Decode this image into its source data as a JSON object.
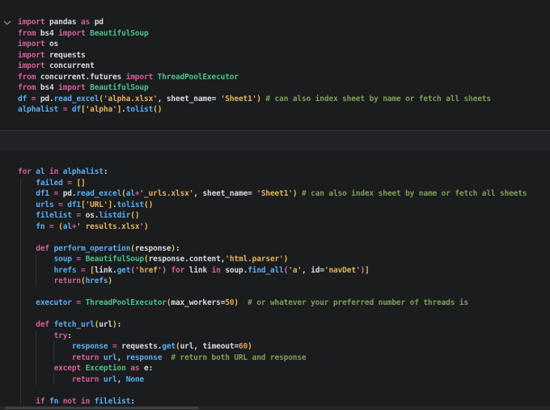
{
  "editor": {
    "palette": {
      "kw": "#d45f9c",
      "v": "#58aef2",
      "c": "#4cc08a",
      "s": "#e1b05e",
      "n": "#dda05c",
      "cm": "#7d9e57",
      "pl": "#d6dae2",
      "b1": "#e8c64b",
      "b2": "#d577d1"
    },
    "cells": [
      {
        "name": "imports-cell",
        "lines": [
          [
            [
              "import",
              "kw"
            ],
            [
              " pandas ",
              "pl"
            ],
            [
              "as",
              "kw"
            ],
            [
              " pd",
              "pl"
            ]
          ],
          [
            [
              "from",
              "kw"
            ],
            [
              " bs4 ",
              "pl"
            ],
            [
              "import",
              "kw"
            ],
            [
              " ",
              "pl"
            ],
            [
              "BeautifulSoup",
              "c"
            ]
          ],
          [
            [
              "import",
              "kw"
            ],
            [
              " os",
              "pl"
            ]
          ],
          [
            [
              "import",
              "kw"
            ],
            [
              " requests",
              "pl"
            ]
          ],
          [
            [
              "import",
              "kw"
            ],
            [
              " concurrent",
              "pl"
            ]
          ],
          [
            [
              "from",
              "kw"
            ],
            [
              " concurrent.futures ",
              "pl"
            ],
            [
              "import",
              "kw"
            ],
            [
              " ",
              "pl"
            ],
            [
              "ThreadPoolExecutor",
              "c"
            ]
          ],
          [
            [
              "from",
              "kw"
            ],
            [
              " bs4 ",
              "pl"
            ],
            [
              "import",
              "kw"
            ],
            [
              " ",
              "pl"
            ],
            [
              "BeautifulSoup",
              "c"
            ]
          ],
          [
            [
              "df",
              "v"
            ],
            [
              " ",
              "pl"
            ],
            [
              "=",
              "kw"
            ],
            [
              " pd",
              "pl"
            ],
            [
              ".",
              "pl"
            ],
            [
              "read_excel",
              "v"
            ],
            [
              "(",
              "b1"
            ],
            [
              "'alpha.xlsx'",
              "s"
            ],
            [
              ", ",
              "pl"
            ],
            [
              "sheet_name",
              "pl"
            ],
            [
              "= ",
              "pl"
            ],
            [
              "'Sheet1'",
              "s"
            ],
            [
              ")",
              "b1"
            ],
            [
              " ",
              "pl"
            ],
            [
              "# can also index sheet by name or fetch all sheets",
              "cm"
            ]
          ],
          [
            [
              "alphalist",
              "v"
            ],
            [
              " ",
              "pl"
            ],
            [
              "=",
              "kw"
            ],
            [
              " ",
              "pl"
            ],
            [
              "df",
              "v"
            ],
            [
              "[",
              "b1"
            ],
            [
              "'alpha'",
              "s"
            ],
            [
              "]",
              "b1"
            ],
            [
              ".",
              "pl"
            ],
            [
              "tolist",
              "v"
            ],
            [
              "(",
              "b1"
            ],
            [
              ")",
              "b1"
            ]
          ]
        ]
      },
      {
        "name": "loop-cell",
        "lines": [
          [
            [
              "for",
              "kw"
            ],
            [
              " ",
              "pl"
            ],
            [
              "al",
              "v"
            ],
            [
              " ",
              "pl"
            ],
            [
              "in",
              "kw"
            ],
            [
              " ",
              "pl"
            ],
            [
              "alphalist",
              "v"
            ],
            [
              ":",
              "pl"
            ]
          ],
          [
            [
              "    ",
              "pl"
            ],
            [
              "failed",
              "v"
            ],
            [
              " ",
              "pl"
            ],
            [
              "=",
              "kw"
            ],
            [
              " ",
              "pl"
            ],
            [
              "[]",
              "b1"
            ]
          ],
          [
            [
              "    ",
              "pl"
            ],
            [
              "df1",
              "v"
            ],
            [
              " ",
              "pl"
            ],
            [
              "=",
              "kw"
            ],
            [
              " pd",
              "pl"
            ],
            [
              ".",
              "pl"
            ],
            [
              "read_excel",
              "v"
            ],
            [
              "(",
              "b1"
            ],
            [
              "al",
              "v"
            ],
            [
              "+",
              "kw"
            ],
            [
              "'_urls.xlsx'",
              "s"
            ],
            [
              ", ",
              "pl"
            ],
            [
              "sheet_name",
              "pl"
            ],
            [
              "= ",
              "pl"
            ],
            [
              "'Sheet1'",
              "s"
            ],
            [
              ")",
              "b1"
            ],
            [
              " ",
              "pl"
            ],
            [
              "# can also index sheet by name or fetch all sheets",
              "cm"
            ]
          ],
          [
            [
              "    ",
              "pl"
            ],
            [
              "urls",
              "v"
            ],
            [
              " ",
              "pl"
            ],
            [
              "=",
              "kw"
            ],
            [
              " ",
              "pl"
            ],
            [
              "df1",
              "v"
            ],
            [
              "[",
              "b1"
            ],
            [
              "'URL'",
              "s"
            ],
            [
              "]",
              "b1"
            ],
            [
              ".",
              "pl"
            ],
            [
              "tolist",
              "v"
            ],
            [
              "(",
              "b1"
            ],
            [
              ")",
              "b1"
            ]
          ],
          [
            [
              "    ",
              "pl"
            ],
            [
              "filelist",
              "v"
            ],
            [
              " ",
              "pl"
            ],
            [
              "=",
              "kw"
            ],
            [
              " os",
              "pl"
            ],
            [
              ".",
              "pl"
            ],
            [
              "listdir",
              "v"
            ],
            [
              "(",
              "b1"
            ],
            [
              ")",
              "b1"
            ]
          ],
          [
            [
              "    ",
              "pl"
            ],
            [
              "fn",
              "v"
            ],
            [
              " ",
              "pl"
            ],
            [
              "=",
              "kw"
            ],
            [
              " ",
              "pl"
            ],
            [
              "(",
              "b1"
            ],
            [
              "al",
              "v"
            ],
            [
              "+",
              "kw"
            ],
            [
              "' results.xlsx'",
              "s"
            ],
            [
              ")",
              "b1"
            ]
          ],
          [],
          [
            [
              "    ",
              "pl"
            ],
            [
              "def",
              "kw"
            ],
            [
              " ",
              "pl"
            ],
            [
              "perform_operation",
              "v"
            ],
            [
              "(",
              "b1"
            ],
            [
              "response",
              "pl"
            ],
            [
              ")",
              "b1"
            ],
            [
              ":",
              "pl"
            ]
          ],
          [
            [
              "        ",
              "pl"
            ],
            [
              "soup",
              "v"
            ],
            [
              " ",
              "pl"
            ],
            [
              "=",
              "kw"
            ],
            [
              " ",
              "pl"
            ],
            [
              "BeautifulSoup",
              "c"
            ],
            [
              "(",
              "b1"
            ],
            [
              "response.content",
              "pl"
            ],
            [
              ",",
              "pl"
            ],
            [
              "'html.parser'",
              "s"
            ],
            [
              ")",
              "b1"
            ]
          ],
          [
            [
              "        ",
              "pl"
            ],
            [
              "hrefs",
              "v"
            ],
            [
              " ",
              "pl"
            ],
            [
              "=",
              "kw"
            ],
            [
              " ",
              "pl"
            ],
            [
              "[",
              "b1"
            ],
            [
              "link",
              "pl"
            ],
            [
              ".",
              "pl"
            ],
            [
              "get",
              "v"
            ],
            [
              "(",
              "b2"
            ],
            [
              "'href'",
              "s"
            ],
            [
              ")",
              "b2"
            ],
            [
              " ",
              "pl"
            ],
            [
              "for",
              "kw"
            ],
            [
              " link ",
              "pl"
            ],
            [
              "in",
              "kw"
            ],
            [
              " soup",
              "pl"
            ],
            [
              ".",
              "pl"
            ],
            [
              "find_all",
              "v"
            ],
            [
              "(",
              "b2"
            ],
            [
              "'a'",
              "s"
            ],
            [
              ", ",
              "pl"
            ],
            [
              "id",
              "pl"
            ],
            [
              "=",
              "pl"
            ],
            [
              "'navDet'",
              "s"
            ],
            [
              ")",
              "b2"
            ],
            [
              "]",
              "b1"
            ]
          ],
          [
            [
              "        ",
              "pl"
            ],
            [
              "return",
              "kw"
            ],
            [
              "(",
              "b1"
            ],
            [
              "hrefs",
              "v"
            ],
            [
              ")",
              "b1"
            ]
          ],
          [],
          [
            [
              "    ",
              "pl"
            ],
            [
              "executor",
              "v"
            ],
            [
              " ",
              "pl"
            ],
            [
              "=",
              "kw"
            ],
            [
              " ",
              "pl"
            ],
            [
              "ThreadPoolExecutor",
              "c"
            ],
            [
              "(",
              "b1"
            ],
            [
              "max_workers",
              "pl"
            ],
            [
              "=",
              "pl"
            ],
            [
              "50",
              "n"
            ],
            [
              ")",
              "b1"
            ],
            [
              "  ",
              "pl"
            ],
            [
              "# or whatever your preferred number of threads is",
              "cm"
            ]
          ],
          [],
          [
            [
              "    ",
              "pl"
            ],
            [
              "def",
              "kw"
            ],
            [
              " ",
              "pl"
            ],
            [
              "fetch_url",
              "v"
            ],
            [
              "(",
              "b1"
            ],
            [
              "url",
              "pl"
            ],
            [
              ")",
              "b1"
            ],
            [
              ":",
              "pl"
            ]
          ],
          [
            [
              "        ",
              "pl"
            ],
            [
              "try",
              "kw"
            ],
            [
              ":",
              "pl"
            ]
          ],
          [
            [
              "            ",
              "pl"
            ],
            [
              "response",
              "v"
            ],
            [
              " ",
              "pl"
            ],
            [
              "=",
              "kw"
            ],
            [
              " requests",
              "pl"
            ],
            [
              ".",
              "pl"
            ],
            [
              "get",
              "v"
            ],
            [
              "(",
              "b1"
            ],
            [
              "url",
              "pl"
            ],
            [
              ", ",
              "pl"
            ],
            [
              "timeout",
              "pl"
            ],
            [
              "=",
              "pl"
            ],
            [
              "60",
              "n"
            ],
            [
              ")",
              "b1"
            ]
          ],
          [
            [
              "            ",
              "pl"
            ],
            [
              "return",
              "kw"
            ],
            [
              " ",
              "pl"
            ],
            [
              "url",
              "v"
            ],
            [
              ", ",
              "pl"
            ],
            [
              "response",
              "v"
            ],
            [
              "  ",
              "pl"
            ],
            [
              "# return both URL and response",
              "cm"
            ]
          ],
          [
            [
              "        ",
              "pl"
            ],
            [
              "except",
              "kw"
            ],
            [
              " ",
              "pl"
            ],
            [
              "Exception",
              "c"
            ],
            [
              " ",
              "pl"
            ],
            [
              "as",
              "kw"
            ],
            [
              " e",
              "pl"
            ],
            [
              ":",
              "pl"
            ]
          ],
          [
            [
              "            ",
              "pl"
            ],
            [
              "return",
              "kw"
            ],
            [
              " ",
              "pl"
            ],
            [
              "url",
              "v"
            ],
            [
              ", ",
              "pl"
            ],
            [
              "None",
              "v"
            ]
          ],
          [],
          [
            [
              "    ",
              "pl"
            ],
            [
              "if",
              "kw"
            ],
            [
              " ",
              "pl"
            ],
            [
              "fn",
              "v"
            ],
            [
              " ",
              "pl"
            ],
            [
              "not",
              "kw"
            ],
            [
              " ",
              "pl"
            ],
            [
              "in",
              "kw"
            ],
            [
              " ",
              "pl"
            ],
            [
              "filelist",
              "v"
            ],
            [
              ":",
              "pl"
            ]
          ]
        ]
      }
    ]
  }
}
